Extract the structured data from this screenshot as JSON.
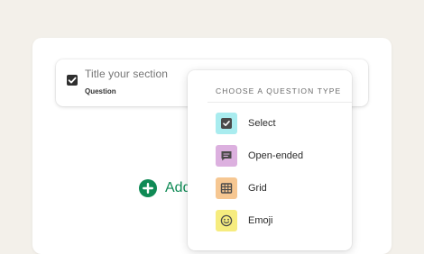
{
  "section": {
    "title_placeholder": "Title your section",
    "subtitle": "Question"
  },
  "add_button": {
    "label": "Add"
  },
  "question_menu": {
    "header": "CHOOSE A QUESTION TYPE",
    "options": [
      {
        "label": "Select",
        "icon": "checkbox-icon",
        "color": "#a9ecef"
      },
      {
        "label": "Open-ended",
        "icon": "comment-icon",
        "color": "#dcb0df"
      },
      {
        "label": "Grid",
        "icon": "table-grid-icon",
        "color": "#f6c792"
      },
      {
        "label": "Emoji",
        "icon": "smiley-icon",
        "color": "#f6ec7f"
      }
    ]
  },
  "colors": {
    "accent": "#0f8a55",
    "background": "#f3f0ea"
  }
}
